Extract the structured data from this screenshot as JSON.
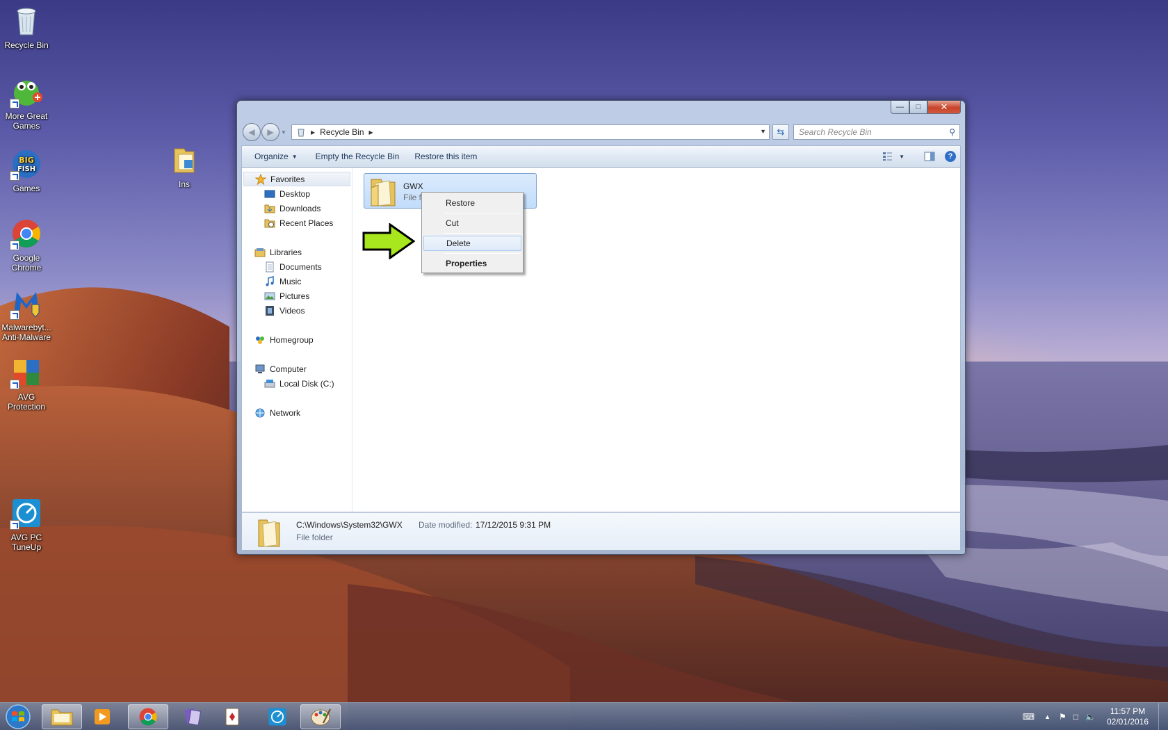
{
  "desktop": {
    "icons": [
      {
        "label": "Recycle Bin"
      },
      {
        "label": "More Great Games"
      },
      {
        "label": "Games"
      },
      {
        "label": "Ins"
      },
      {
        "label": "Google Chrome"
      },
      {
        "label": "Malwarebyt... Anti-Malware"
      },
      {
        "label": "AVG Protection"
      },
      {
        "label": "AVG PC TuneUp"
      }
    ]
  },
  "window": {
    "breadcrumb": [
      "Recycle Bin"
    ],
    "search_placeholder": "Search Recycle Bin",
    "toolbar": {
      "organize": "Organize",
      "empty": "Empty the Recycle Bin",
      "restore_item": "Restore this item"
    },
    "navpane": {
      "favorites": "Favorites",
      "desktop": "Desktop",
      "downloads": "Downloads",
      "recent": "Recent Places",
      "libraries": "Libraries",
      "documents": "Documents",
      "music": "Music",
      "pictures": "Pictures",
      "videos": "Videos",
      "homegroup": "Homegroup",
      "computer": "Computer",
      "localdisk": "Local Disk (C:)",
      "network": "Network"
    },
    "item": {
      "name": "GWX",
      "type": "File folder"
    },
    "context_menu": {
      "restore": "Restore",
      "cut": "Cut",
      "delete": "Delete",
      "properties": "Properties"
    },
    "details": {
      "path": "C:\\Windows\\System32\\GWX",
      "date_label": "Date modified:",
      "date_value": "17/12/2015 9:31 PM",
      "type": "File folder"
    }
  },
  "taskbar": {
    "time": "11:57 PM",
    "date": "02/01/2016"
  },
  "colors": {
    "accent_arrow": "#a8e61d",
    "selection": "#c1dcfb"
  }
}
